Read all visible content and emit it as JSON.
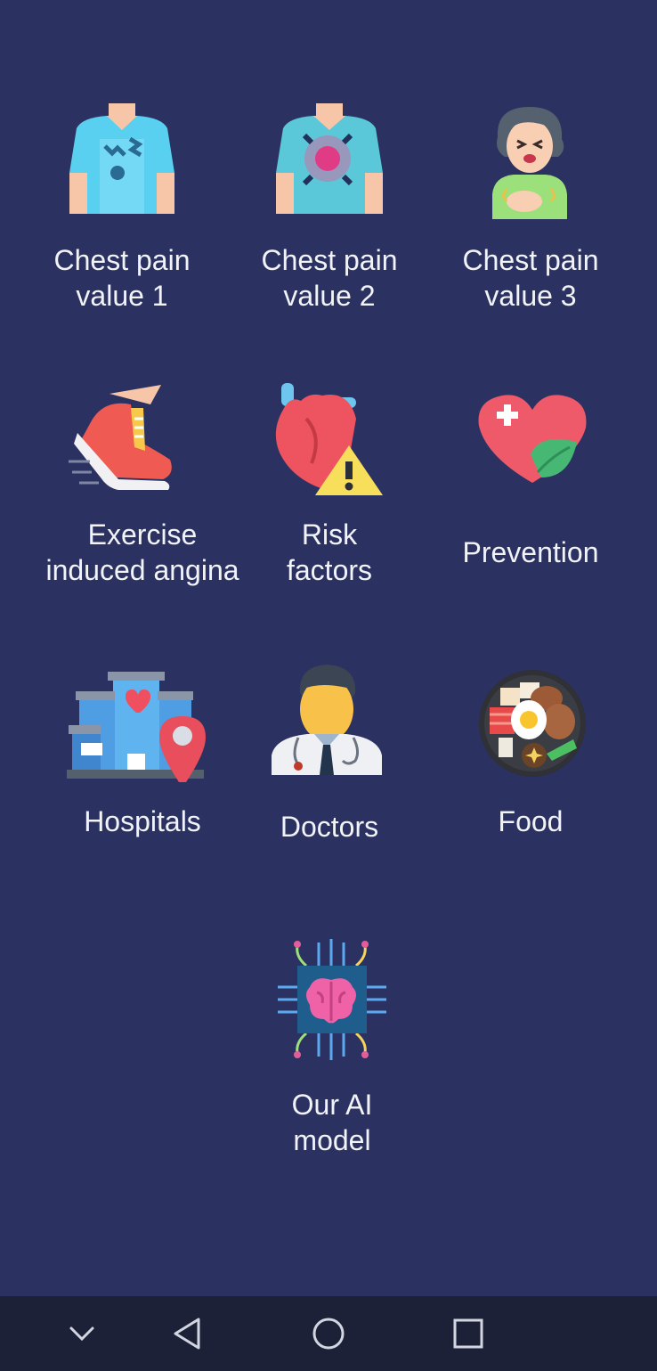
{
  "tiles": [
    {
      "label": "Chest pain\nvalue 1",
      "icon": "chest-pain-shirt-icon"
    },
    {
      "label": "Chest pain\nvalue 2",
      "icon": "chest-pain-radiating-icon"
    },
    {
      "label": "Chest pain\nvalue 3",
      "icon": "person-in-pain-icon"
    },
    {
      "label": "Exercise\ninduced angina",
      "icon": "running-shoe-icon"
    },
    {
      "label": "Risk\nfactors",
      "icon": "heart-warning-icon"
    },
    {
      "label": "Prevention",
      "icon": "heart-leaf-icon"
    },
    {
      "label": "Hospitals",
      "icon": "hospital-location-icon"
    },
    {
      "label": "Doctors",
      "icon": "doctor-icon"
    },
    {
      "label": "Food",
      "icon": "food-plate-icon"
    },
    {
      "label": "Our AI\nmodel",
      "icon": "ai-brain-chip-icon"
    }
  ],
  "nav": {
    "buttons": [
      "chevron-down-icon",
      "back-icon",
      "home-icon",
      "recents-icon"
    ]
  },
  "colors": {
    "background": "#2b3261",
    "navbar": "#1c2138",
    "text": "#f2f3f7"
  }
}
